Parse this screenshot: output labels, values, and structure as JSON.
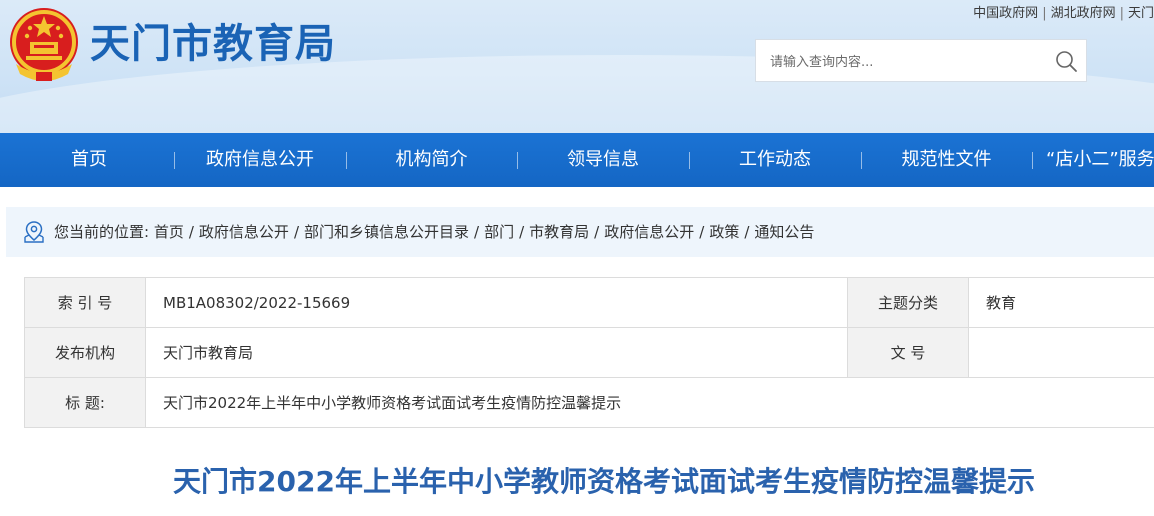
{
  "header": {
    "site_title": "天门市教育局",
    "top_links": [
      "中国政府网",
      "湖北政府网",
      "天门"
    ],
    "search": {
      "placeholder": "请输入查询内容..."
    },
    "emblem_icon": "national-emblem-icon",
    "colors": {
      "title": "#1a63b5",
      "nav": "#1466c4",
      "article_title": "#2a62ad"
    }
  },
  "nav": {
    "items": [
      {
        "label": "首页"
      },
      {
        "label": "政府信息公开"
      },
      {
        "label": "机构简介"
      },
      {
        "label": "领导信息"
      },
      {
        "label": "工作动态"
      },
      {
        "label": "规范性文件"
      },
      {
        "label": "“店小二”服务"
      }
    ]
  },
  "breadcrumb": {
    "prefix": "您当前的位置:",
    "items": [
      "首页",
      "政府信息公开",
      "部门和乡镇信息公开目录",
      "部门",
      "市教育局",
      "政府信息公开",
      "政策",
      "通知公告"
    ]
  },
  "info": {
    "index_label": "索 引 号",
    "index_value": "MB1A08302/2022-15669",
    "category_label": "主题分类",
    "category_value": "教育",
    "publisher_label": "发布机构",
    "publisher_value": "天门市教育局",
    "docnum_label": "文 号",
    "docnum_value": "",
    "title_label": "标 题:",
    "title_value": "天门市2022年上半年中小学教师资格考试面试考生疫情防控温馨提示"
  },
  "article": {
    "title": "天门市2022年上半年中小学教师资格考试面试考生疫情防控温馨提示"
  }
}
